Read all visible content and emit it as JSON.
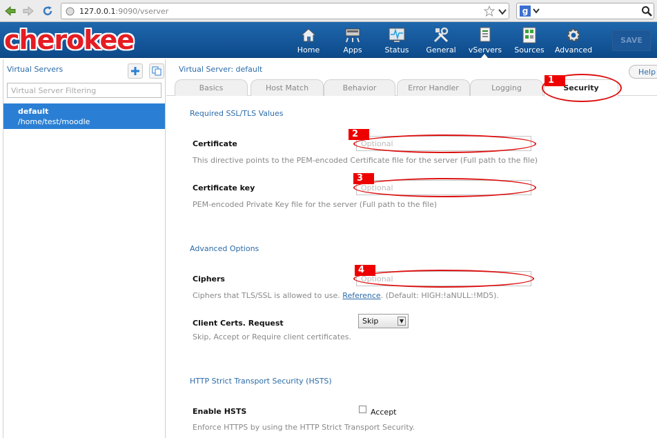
{
  "browser": {
    "url_host": "127.0.0.1",
    "url_rest": ":9090/vserver"
  },
  "app": {
    "logo": "cherokee",
    "nav": [
      {
        "label": "Home",
        "icon": "home-icon"
      },
      {
        "label": "Apps",
        "icon": "apps-icon"
      },
      {
        "label": "Status",
        "icon": "status-icon"
      },
      {
        "label": "General",
        "icon": "tools-icon"
      },
      {
        "label": "vServers",
        "icon": "vservers-icon"
      },
      {
        "label": "Sources",
        "icon": "sources-icon"
      },
      {
        "label": "Advanced",
        "icon": "gear-icon"
      }
    ],
    "save_label": "SAVE"
  },
  "sidebar": {
    "title": "Virtual Servers",
    "filter_placeholder": "Virtual Server Filtering",
    "selected": {
      "name": "default",
      "path": "/home/test/moodle"
    }
  },
  "main": {
    "title": "Virtual Server: default",
    "help": "Help",
    "tabs": [
      "Basics",
      "Host Match",
      "Behavior",
      "Error Handler",
      "Logging",
      "Security"
    ],
    "active_tab": "Security",
    "sections": {
      "ssl": "Required SSL/TLS Values",
      "advanced": "Advanced Options",
      "hsts": "HTTP Strict Transport Security (HSTS)"
    },
    "fields": {
      "certificate": {
        "label": "Certificate",
        "placeholder": "Optional",
        "help": "This directive points to the PEM-encoded Certificate file for the server (Full path to the file)"
      },
      "certificate_key": {
        "label": "Certificate key",
        "placeholder": "Optional",
        "help": "PEM-encoded Private Key file for the server (Full path to the file)"
      },
      "ciphers": {
        "label": "Ciphers",
        "placeholder": "Optional",
        "help_pre": "Ciphers that TLS/SSL is allowed to use.",
        "help_link": "Reference",
        "help_post": ". (Default: HIGH:!aNULL:!MD5)."
      },
      "client_certs": {
        "label": "Client Certs. Request",
        "value": "Skip",
        "help": "Skip, Accept or Require client certificates."
      },
      "hsts": {
        "label": "Enable HSTS",
        "checkbox_label": "Accept",
        "checked": false,
        "help": "Enforce HTTPS by using the HTTP Strict Transport Security."
      }
    }
  },
  "annotations": [
    "1",
    "2",
    "3",
    "4"
  ],
  "colors": {
    "header": "#1a5fa3",
    "accent": "#2a7fd4",
    "annotation": "#ee0000",
    "logo": "#e51c23"
  }
}
